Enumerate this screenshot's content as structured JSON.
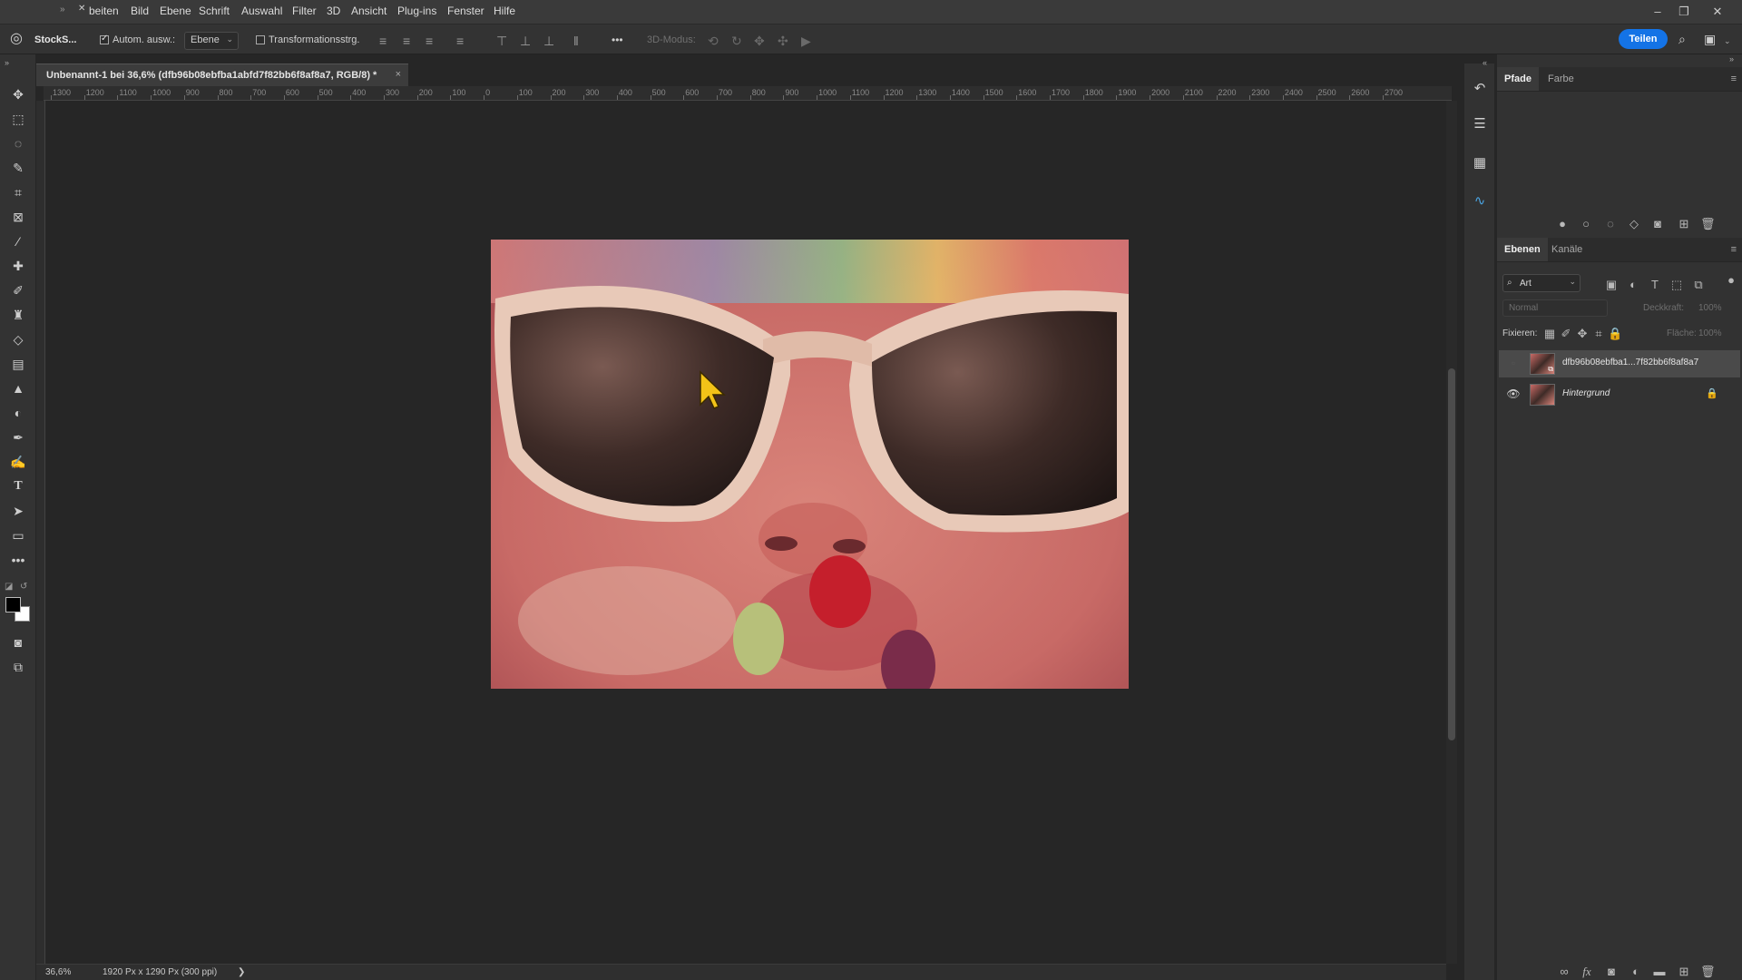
{
  "menubar": {
    "items": [
      "beiten",
      "Bild",
      "Ebene",
      "Schrift",
      "Auswahl",
      "Filter",
      "3D",
      "Ansicht",
      "Plug-ins",
      "Fenster",
      "Hilfe"
    ],
    "app_label": "StockS...",
    "window_buttons": [
      "–",
      "❐",
      "✕"
    ]
  },
  "options": {
    "auto_select_label": "Autom. ausw.:",
    "auto_select_checked": true,
    "target_value": "Ebene",
    "transform_label": "Transformationsstrg.",
    "transform_checked": false,
    "more_label": "•••",
    "mode3d_label": "3D-Modus:",
    "share_label": "Teilen"
  },
  "document": {
    "tab_title": "Unbenannt-1 bei 36,6% (dfb96b08ebfba1abfd7f82bb6f8af8a7, RGB/8) *",
    "close_label": "×",
    "zoom": "36,6%",
    "info": "1920 Px x 1290 Px (300 ppi)",
    "status_arrow": "❯"
  },
  "ruler": {
    "labels": [
      "1300",
      "1200",
      "1100",
      "1000",
      "900",
      "800",
      "700",
      "600",
      "500",
      "400",
      "300",
      "200",
      "100",
      "0",
      "100",
      "200",
      "300",
      "400",
      "500",
      "600",
      "700",
      "800",
      "900",
      "1000",
      "1100",
      "1200",
      "1300",
      "1400",
      "1500",
      "1600",
      "1700",
      "1800",
      "1900",
      "2000",
      "2100",
      "2200",
      "2300",
      "2400",
      "2500",
      "2600",
      "2700"
    ]
  },
  "tools": [
    "move-tool",
    "marquee-tool",
    "lasso-tool",
    "quick-select-tool",
    "crop-tool",
    "frame-tool",
    "eyedropper-tool",
    "healing-tool",
    "brush-tool",
    "stamp-tool",
    "eraser-tool",
    "gradient-tool",
    "sharpen-tool",
    "dodge-tool",
    "pen-tool",
    "freeform-pen-tool",
    "type-tool",
    "path-select-tool",
    "rectangle-tool",
    "more-tools"
  ],
  "colors": {
    "foreground": "#000000",
    "background": "#ffffff",
    "accent": "#1473e6"
  },
  "panels": {
    "top_tabs": [
      "Pfade",
      "Farbe"
    ],
    "layers_tabs": [
      "Ebenen",
      "Kanäle"
    ],
    "filter_kind": "Art",
    "blend_mode": "Normal",
    "opacity_label": "Deckkraft:",
    "opacity_value": "100%",
    "lock_label": "Fixieren:",
    "fill_label": "Fläche:",
    "fill_value": "100%",
    "layers": [
      {
        "name": "dfb96b08ebfba1...7f82bb6f8af8a7",
        "visible": false,
        "italic": false,
        "locked": false
      },
      {
        "name": "Hintergrund",
        "visible": true,
        "italic": true,
        "locked": true
      }
    ]
  }
}
